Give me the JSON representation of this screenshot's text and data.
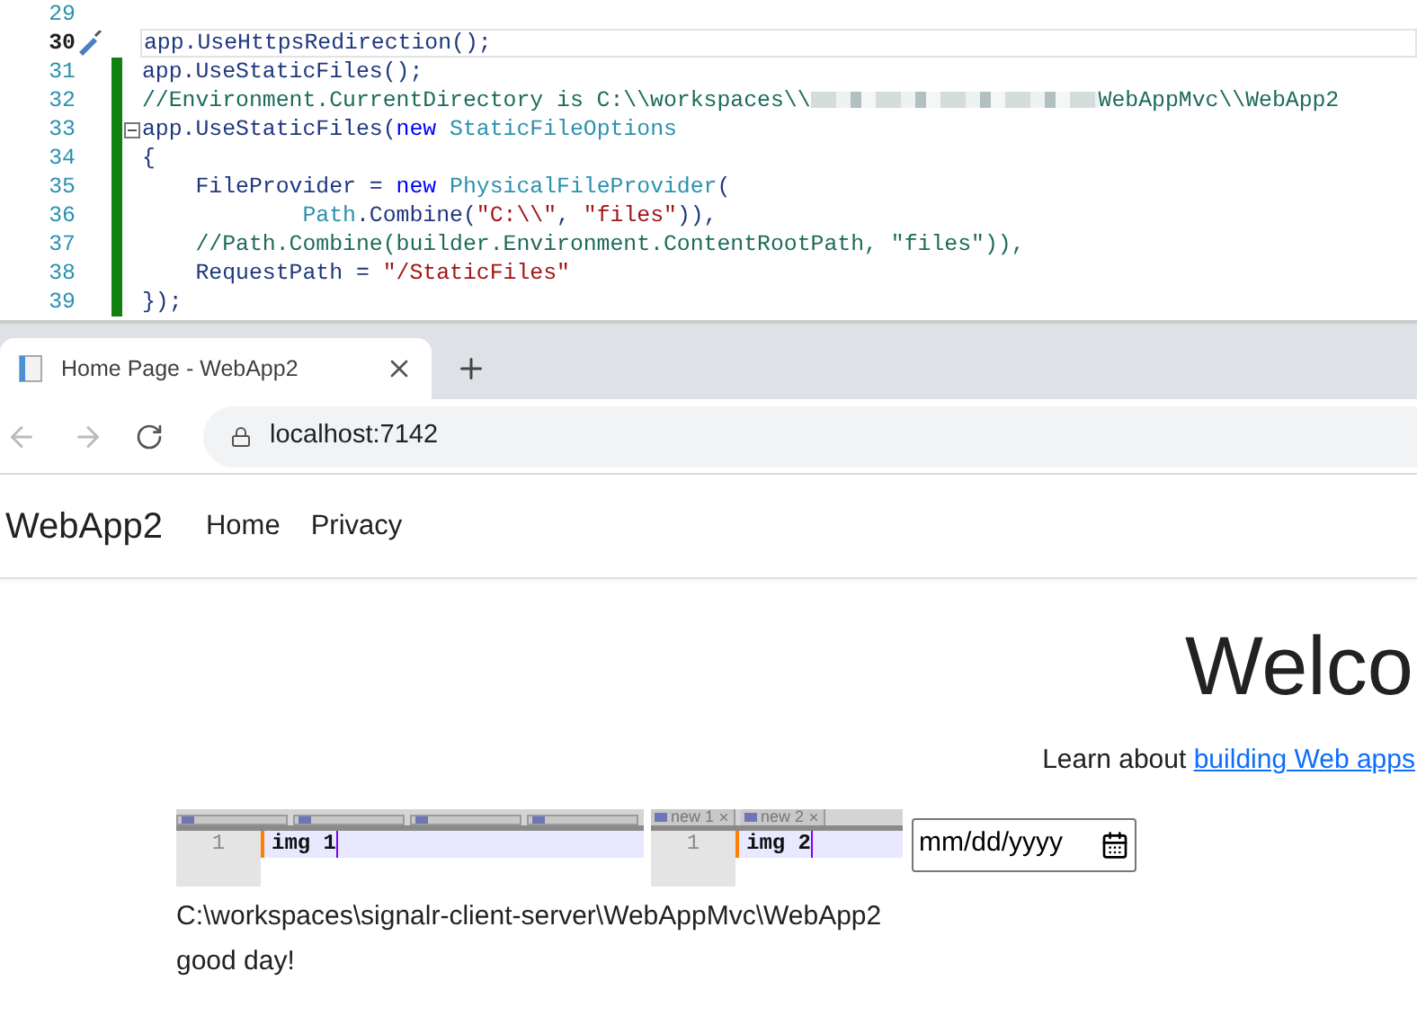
{
  "editor": {
    "lines": [
      {
        "number": "29",
        "current": false,
        "changed": false,
        "fold": false
      },
      {
        "number": "30",
        "current": true,
        "changed": false,
        "fold": false,
        "tokens": [
          {
            "kind": "ident",
            "text": "app.UseHttpsRedirection();"
          }
        ]
      },
      {
        "number": "31",
        "current": false,
        "changed": true,
        "fold": false,
        "tokens": [
          {
            "kind": "ident",
            "text": "app.UseStaticFiles();"
          }
        ]
      },
      {
        "number": "32",
        "current": false,
        "changed": true,
        "fold": false,
        "tokens": [
          {
            "kind": "comment",
            "text": "//Environment.CurrentDirectory is C:\\\\workspaces\\\\"
          },
          {
            "kind": "redacted"
          },
          {
            "kind": "comment",
            "text": "WebAppMvc\\\\WebApp2"
          }
        ]
      },
      {
        "number": "33",
        "current": false,
        "changed": true,
        "fold": true,
        "tokens": [
          {
            "kind": "ident",
            "text": "app.UseStaticFiles("
          },
          {
            "kind": "keyword",
            "text": "new"
          },
          {
            "kind": "type",
            "text": " StaticFileOptions"
          }
        ]
      },
      {
        "number": "34",
        "current": false,
        "changed": true,
        "fold": false,
        "tokens": [
          {
            "kind": "ident",
            "text": "{"
          }
        ]
      },
      {
        "number": "35",
        "current": false,
        "changed": true,
        "fold": false,
        "tokens": [
          {
            "kind": "ident",
            "text": "    FileProvider = "
          },
          {
            "kind": "keyword",
            "text": "new"
          },
          {
            "kind": "type",
            "text": " PhysicalFileProvider"
          },
          {
            "kind": "ident",
            "text": "("
          }
        ]
      },
      {
        "number": "36",
        "current": false,
        "changed": true,
        "fold": false,
        "tokens": [
          {
            "kind": "type",
            "text": "            Path"
          },
          {
            "kind": "ident",
            "text": ".Combine("
          },
          {
            "kind": "string",
            "text": "\"C:\\\\\""
          },
          {
            "kind": "ident",
            "text": ", "
          },
          {
            "kind": "string",
            "text": "\"files\""
          },
          {
            "kind": "ident",
            "text": ")),"
          }
        ]
      },
      {
        "number": "37",
        "current": false,
        "changed": true,
        "fold": false,
        "tokens": [
          {
            "kind": "comment",
            "text": "    //Path.Combine(builder.Environment.ContentRootPath, \"files\")),"
          }
        ]
      },
      {
        "number": "38",
        "current": false,
        "changed": true,
        "fold": false,
        "tokens": [
          {
            "kind": "ident",
            "text": "    RequestPath = "
          },
          {
            "kind": "string",
            "text": "\"/StaticFiles\""
          }
        ]
      },
      {
        "number": "39",
        "current": false,
        "changed": true,
        "fold": false,
        "tokens": [
          {
            "kind": "ident",
            "text": "});"
          }
        ]
      }
    ]
  },
  "browser": {
    "tabs": [
      {
        "title": "Home Page - WebApp2",
        "selected": true
      }
    ],
    "address": "localhost:7142"
  },
  "navbar": {
    "brand": "WebApp2",
    "links": [
      {
        "label": "Home"
      },
      {
        "label": "Privacy"
      }
    ]
  },
  "main": {
    "heading": "Welco",
    "intro": "Learn about",
    "intro_link": "building Web apps",
    "images": [
      {
        "line_number": "1",
        "text": "img 1"
      },
      {
        "tabs": [
          {
            "label": "new 1"
          },
          {
            "label": "new 2"
          }
        ],
        "line_number": "1",
        "text": "img 2"
      }
    ],
    "date_placeholder": "mm/dd/yyyy",
    "path": "C:\\workspaces\\signalr-client-server\\WebAppMvc\\WebApp2",
    "greeting": "good day!"
  }
}
